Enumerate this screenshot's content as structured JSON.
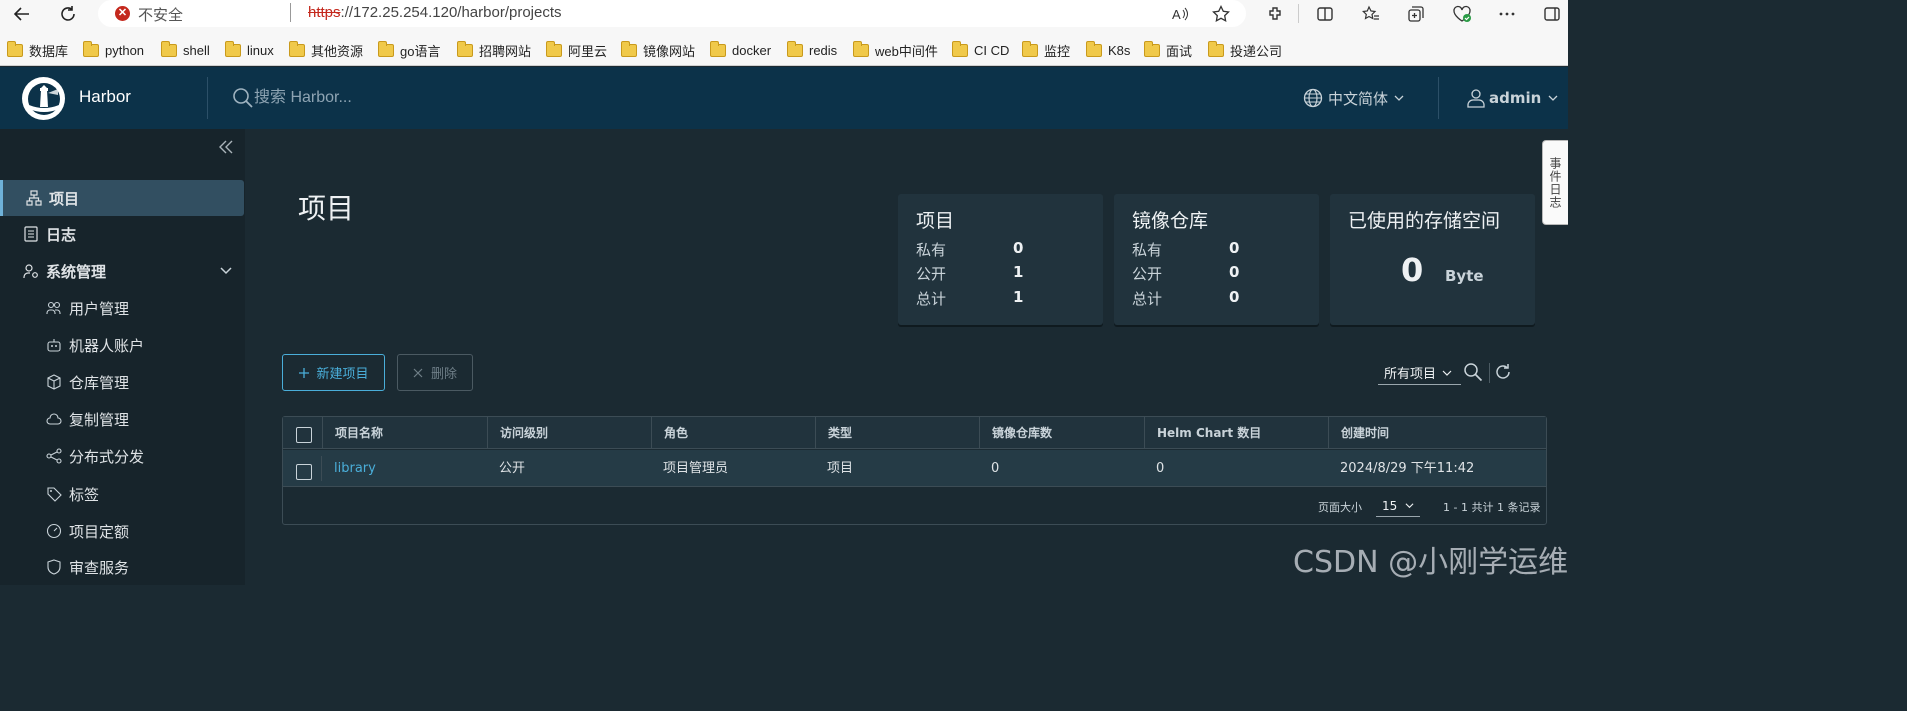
{
  "browser": {
    "insecure_label": "不安全",
    "url_scheme": "https",
    "url_rest": "://172.25.254.120/harbor/projects",
    "bookmarks": [
      "数据库",
      "python",
      "shell",
      "linux",
      "其他资源",
      "go语言",
      "招聘网站",
      "阿里云",
      "镜像网站",
      "docker",
      "redis",
      "web中间件",
      "CI CD",
      "监控",
      "K8s",
      "面试",
      "投递公司"
    ]
  },
  "header": {
    "app_title": "Harbor",
    "search_placeholder": "搜索 Harbor...",
    "language": "中文简体",
    "user": "admin"
  },
  "sidebar": {
    "items": [
      {
        "label": "项目",
        "icon": "projects-icon"
      },
      {
        "label": "日志",
        "icon": "logs-icon"
      },
      {
        "label": "系统管理",
        "icon": "admin-icon"
      },
      {
        "label": "用户管理",
        "icon": "users-icon"
      },
      {
        "label": "机器人账户",
        "icon": "robot-icon"
      },
      {
        "label": "仓库管理",
        "icon": "registry-icon"
      },
      {
        "label": "复制管理",
        "icon": "replication-icon"
      },
      {
        "label": "分布式分发",
        "icon": "distribution-icon"
      },
      {
        "label": "标签",
        "icon": "tag-icon"
      },
      {
        "label": "项目定额",
        "icon": "quota-icon"
      },
      {
        "label": "审查服务",
        "icon": "scanner-icon"
      }
    ]
  },
  "main": {
    "title": "项目",
    "cards": {
      "projects": {
        "title": "项目",
        "rows": [
          {
            "label": "私有",
            "value": "0"
          },
          {
            "label": "公开",
            "value": "1"
          },
          {
            "label": "总计",
            "value": "1"
          }
        ]
      },
      "repos": {
        "title": "镜像仓库",
        "rows": [
          {
            "label": "私有",
            "value": "0"
          },
          {
            "label": "公开",
            "value": "0"
          },
          {
            "label": "总计",
            "value": "0"
          }
        ]
      },
      "storage": {
        "title": "已使用的存储空间",
        "value": "0",
        "unit": "Byte"
      }
    },
    "buttons": {
      "new_project": "新建项目",
      "delete": "删除"
    },
    "filter": "所有项目",
    "table": {
      "columns": [
        "项目名称",
        "访问级别",
        "角色",
        "类型",
        "镜像仓库数",
        "Helm Chart 数目",
        "创建时间"
      ],
      "rows": [
        {
          "name": "library",
          "access": "公开",
          "role": "项目管理员",
          "type": "项目",
          "repo_count": "0",
          "chart_count": "0",
          "created": "2024/8/29 下午11:42"
        }
      ],
      "page_size_label": "页面大小",
      "page_size": "15",
      "pagination": "1 - 1 共计 1 条记录"
    },
    "side_tab": "事件日志"
  },
  "watermark": "CSDN @小刚学运维"
}
